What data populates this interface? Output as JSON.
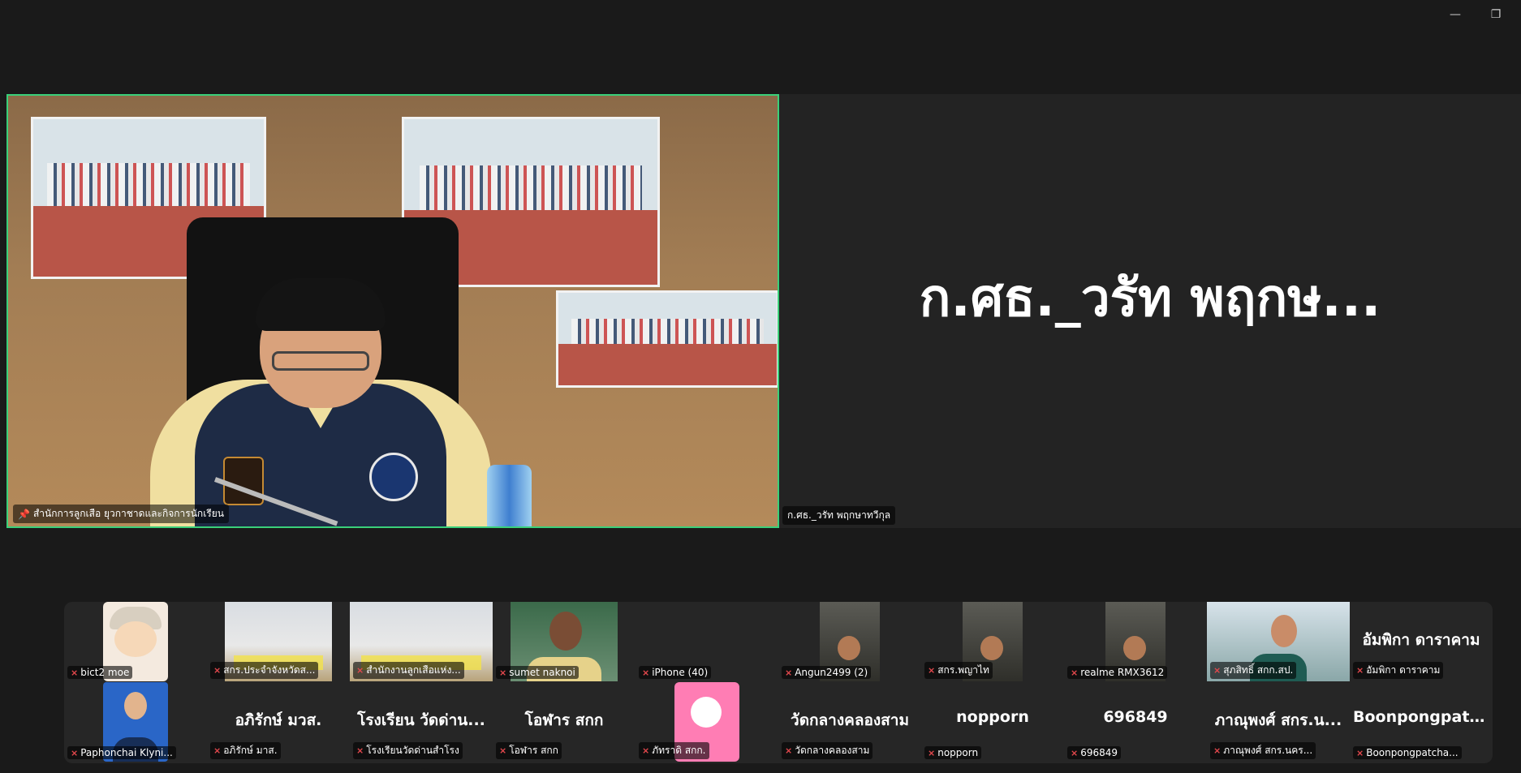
{
  "window": {
    "minimize_icon": "—",
    "restore_icon": "❐"
  },
  "active_speaker": {
    "name": "สำนักการลูกเสือ ยุวกาชาดและกิจการนักเรียน"
  },
  "spotlight": {
    "display_name": "ก.ศธ._วรัท พฤกษ...",
    "name": "ก.ศธ._วรัท พฤกษาทวีกุล"
  },
  "gallery": {
    "row1": [
      {
        "label": "bict2 moe",
        "type": "cartoon"
      },
      {
        "label": "สกร.ประจำจังหวัดส...",
        "type": "room"
      },
      {
        "label": "สำนักงานลูกเสือแห่ง...",
        "type": "room"
      },
      {
        "label": "sumet naknoi",
        "type": "man"
      },
      {
        "label": "iPhone (40)",
        "type": "blank"
      },
      {
        "label": "Angun2499 (2)",
        "type": "dark"
      },
      {
        "label": "สกร.พญาไท",
        "type": "dark"
      },
      {
        "label": "realme RMX3612",
        "type": "dark"
      },
      {
        "label": "สุภสิทธิ์ สกก.สป.",
        "type": "office"
      },
      {
        "label": "อัมพิกา ดาราคาม",
        "display": "อัมพิกา ดาราคาม",
        "type": "text"
      }
    ],
    "row2": [
      {
        "label": "Paphonchai Klyni...",
        "type": "suit"
      },
      {
        "label": "อภิรักษ์ มาส.",
        "display": "อภิรักษ์ มวส.",
        "type": "text"
      },
      {
        "label": "โรงเรียนวัดด่านสำโรง",
        "display": "โรงเรียน วัดด่าน...",
        "type": "text"
      },
      {
        "label": "โอฬาร  สกก",
        "display": "โอฬาร  สกก",
        "type": "text"
      },
      {
        "label": "ภัทราดิ สกก.",
        "type": "pink"
      },
      {
        "label": "วัดกลางคลองสาม",
        "display": "วัดกลางคลองสาม",
        "type": "text"
      },
      {
        "label": "nopporn",
        "display": "nopporn",
        "type": "text"
      },
      {
        "label": "696849",
        "display": "696849",
        "type": "text"
      },
      {
        "label": "ภาณุพงศ์ สกร.นคร...",
        "display": "ภาณุพงศ์ สกร.น...",
        "type": "text"
      },
      {
        "label": "Boonpongpatcha...",
        "display": "Boonpongpatc...",
        "type": "text"
      }
    ]
  }
}
